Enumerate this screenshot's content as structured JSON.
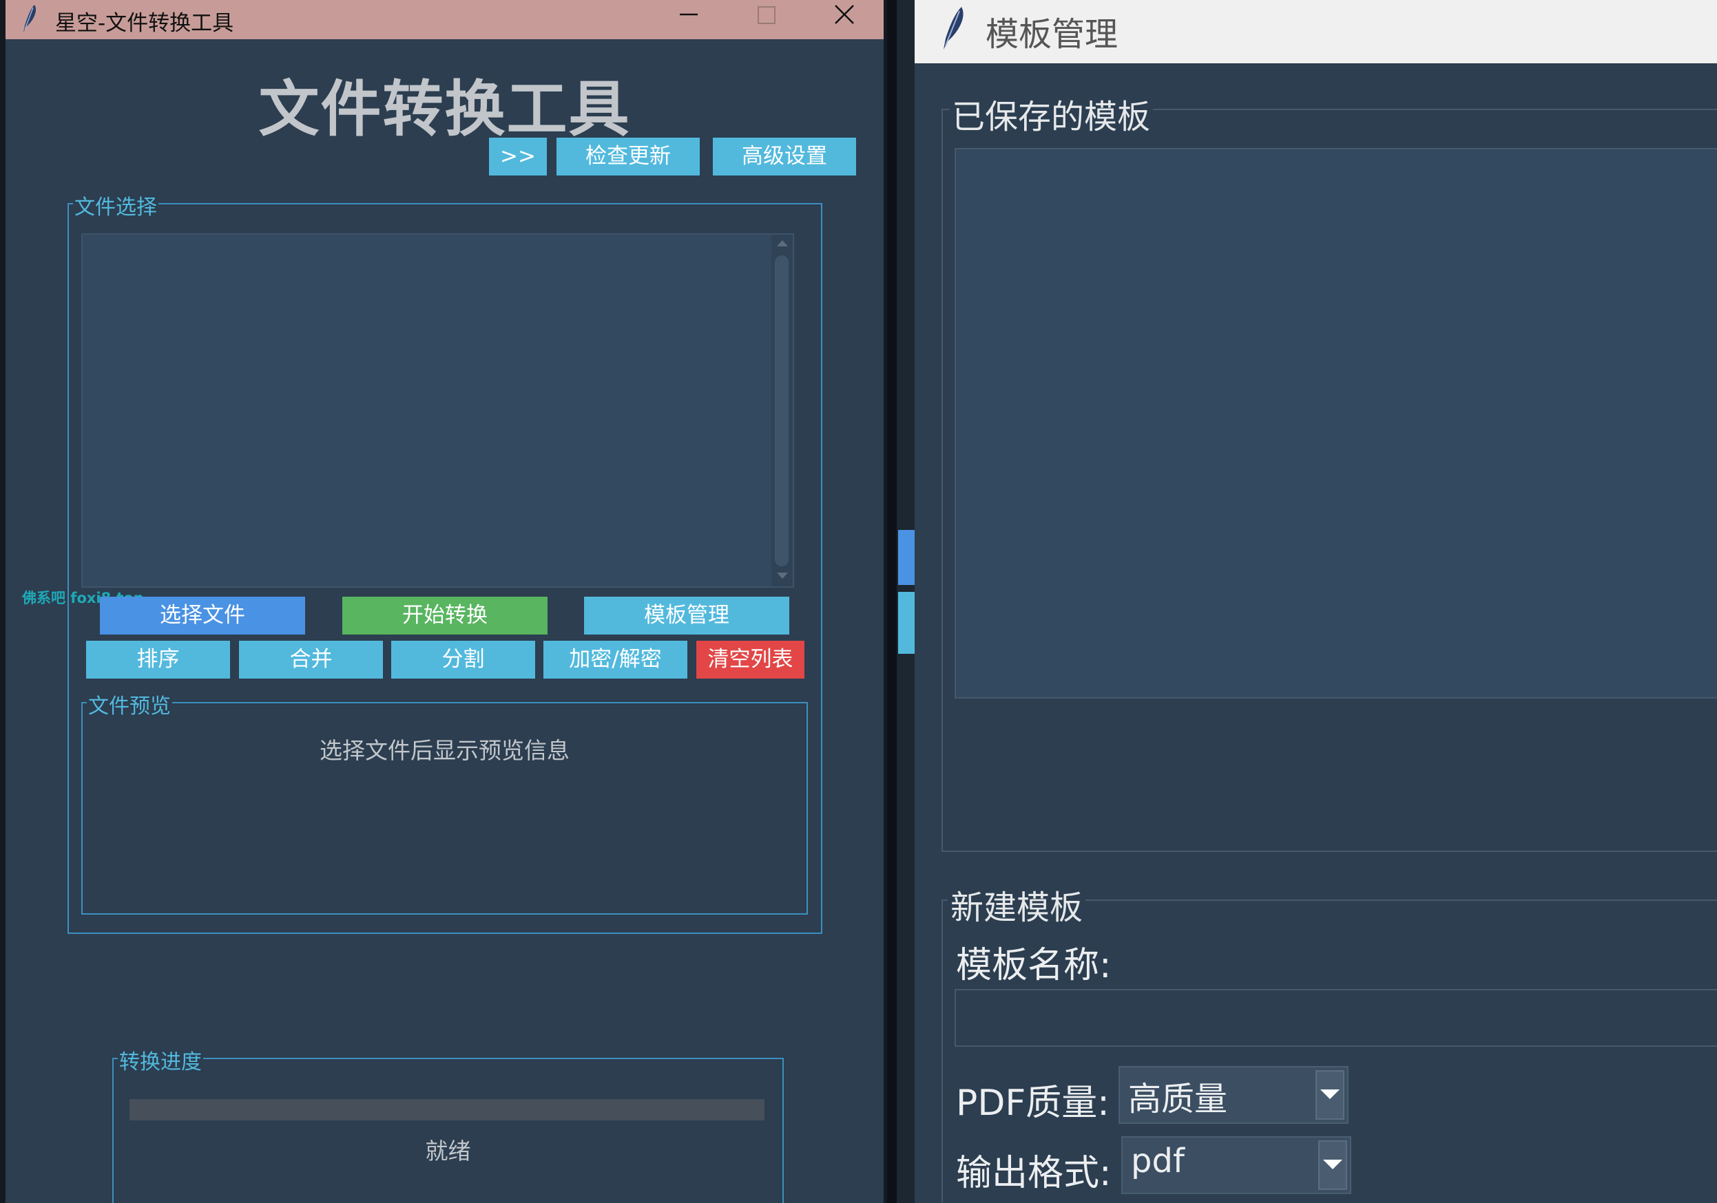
{
  "main_window": {
    "title": "星空-文件转换工具",
    "app_title": "文件转换工具",
    "header_buttons": {
      "expand": ">>",
      "check_update": "检查更新",
      "advanced_settings": "高级设置"
    },
    "file_selection": {
      "label": "文件选择",
      "files": []
    },
    "watermark": "佛系吧 foxi8.top",
    "action_buttons": {
      "select_files": "选择文件",
      "start_convert": "开始转换",
      "template_manage": "模板管理",
      "sort": "排序",
      "merge": "合并",
      "split": "分割",
      "encrypt_decrypt": "加密/解密",
      "clear_list": "清空列表"
    },
    "file_preview": {
      "label": "文件预览",
      "placeholder": "选择文件后显示预览信息"
    },
    "progress": {
      "label": "转换进度",
      "value": 0,
      "status": "就绪"
    }
  },
  "template_window": {
    "title": "模板管理",
    "saved_templates": {
      "label": "已保存的模板",
      "items": []
    },
    "new_template": {
      "label": "新建模板",
      "name_label": "模板名称:",
      "name_value": "",
      "pdf_quality_label": "PDF质量:",
      "pdf_quality_value": "高质量",
      "output_format_label": "输出格式:",
      "output_format_value": "pdf"
    }
  },
  "colors": {
    "window_bg": "#2c3e50",
    "titlebar": "#c79c98",
    "accent_cyan": "#52b9dd",
    "accent_blue": "#4a92e3",
    "accent_green": "#59b560",
    "danger_red": "#e24646"
  }
}
